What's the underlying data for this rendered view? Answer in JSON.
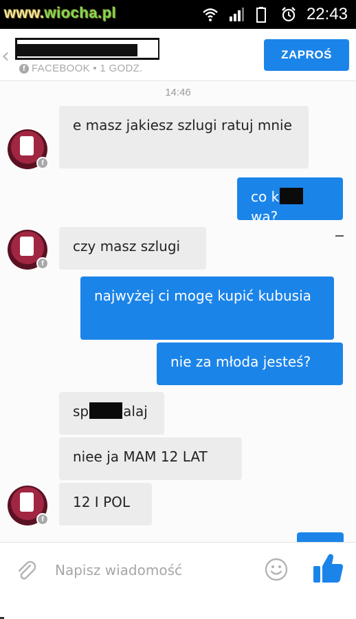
{
  "statusbar": {
    "watermark_prefix": "www.",
    "watermark_site": "wiocha.pl",
    "time": "22:43",
    "icons": [
      "wifi-icon",
      "signal-icon",
      "battery-icon",
      "alarm-icon"
    ]
  },
  "header": {
    "back_icon": "chevron-left-icon",
    "subtitle": "FACEBOOK • 1 GODZ.",
    "invite_label": "ZAPROŚ",
    "accent": "#1b84e9"
  },
  "chat": {
    "timestamp": "14:46",
    "messages": [
      {
        "dir": "in",
        "text": "e masz jakiesz szlugi ratuj mnie"
      },
      {
        "dir": "out",
        "pre": "co k",
        "post": "wa?"
      },
      {
        "dir": "in",
        "text": "czy masz szlugi"
      },
      {
        "dir": "out",
        "text": "najwyżej ci mogę kupić kubusia"
      },
      {
        "dir": "out",
        "text": "nie za młoda jesteś?"
      },
      {
        "dir": "in",
        "pre": "sp",
        "post": "alaj"
      },
      {
        "dir": "in",
        "text": "niee ja MAM 12 LAT"
      },
      {
        "dir": "in",
        "text": "12 I POL"
      }
    ]
  },
  "composer": {
    "placeholder": "Napisz wiadomość",
    "icons": [
      "paperclip-icon",
      "smiley-icon",
      "thumbs-up-icon"
    ]
  },
  "colors": {
    "incoming_bubble": "#ececec",
    "outgoing_bubble": "#1b84e9"
  }
}
